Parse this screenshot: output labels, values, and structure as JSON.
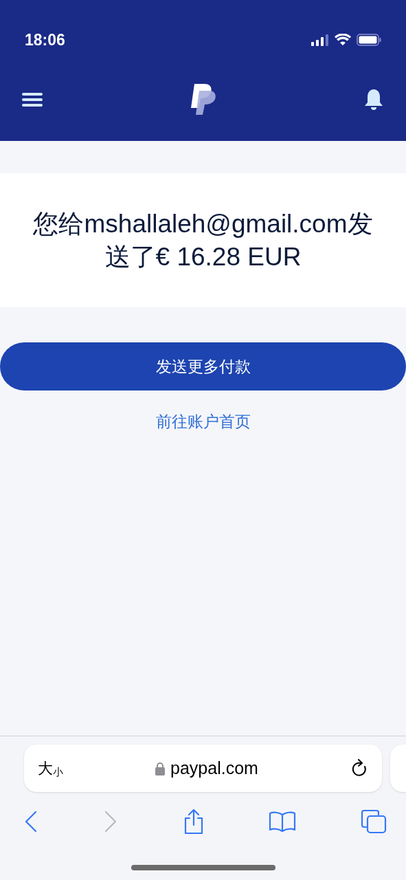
{
  "status_bar": {
    "time": "18:06"
  },
  "message": {
    "text": "您给mshallaleh@gmail.com发送了€ 16.28 EUR"
  },
  "primary_button": {
    "label": "发送更多付款"
  },
  "secondary_link": {
    "label": "前往账户首页"
  },
  "browser": {
    "text_size_big": "大",
    "text_size_small": "小",
    "url": "paypal.com",
    "toolbar": [
      {
        "kind": "back",
        "disabled": false
      },
      {
        "kind": "forward",
        "disabled": true
      },
      {
        "kind": "share",
        "disabled": false
      },
      {
        "kind": "bookmarks",
        "disabled": false
      },
      {
        "kind": "tabs",
        "disabled": false
      }
    ]
  }
}
